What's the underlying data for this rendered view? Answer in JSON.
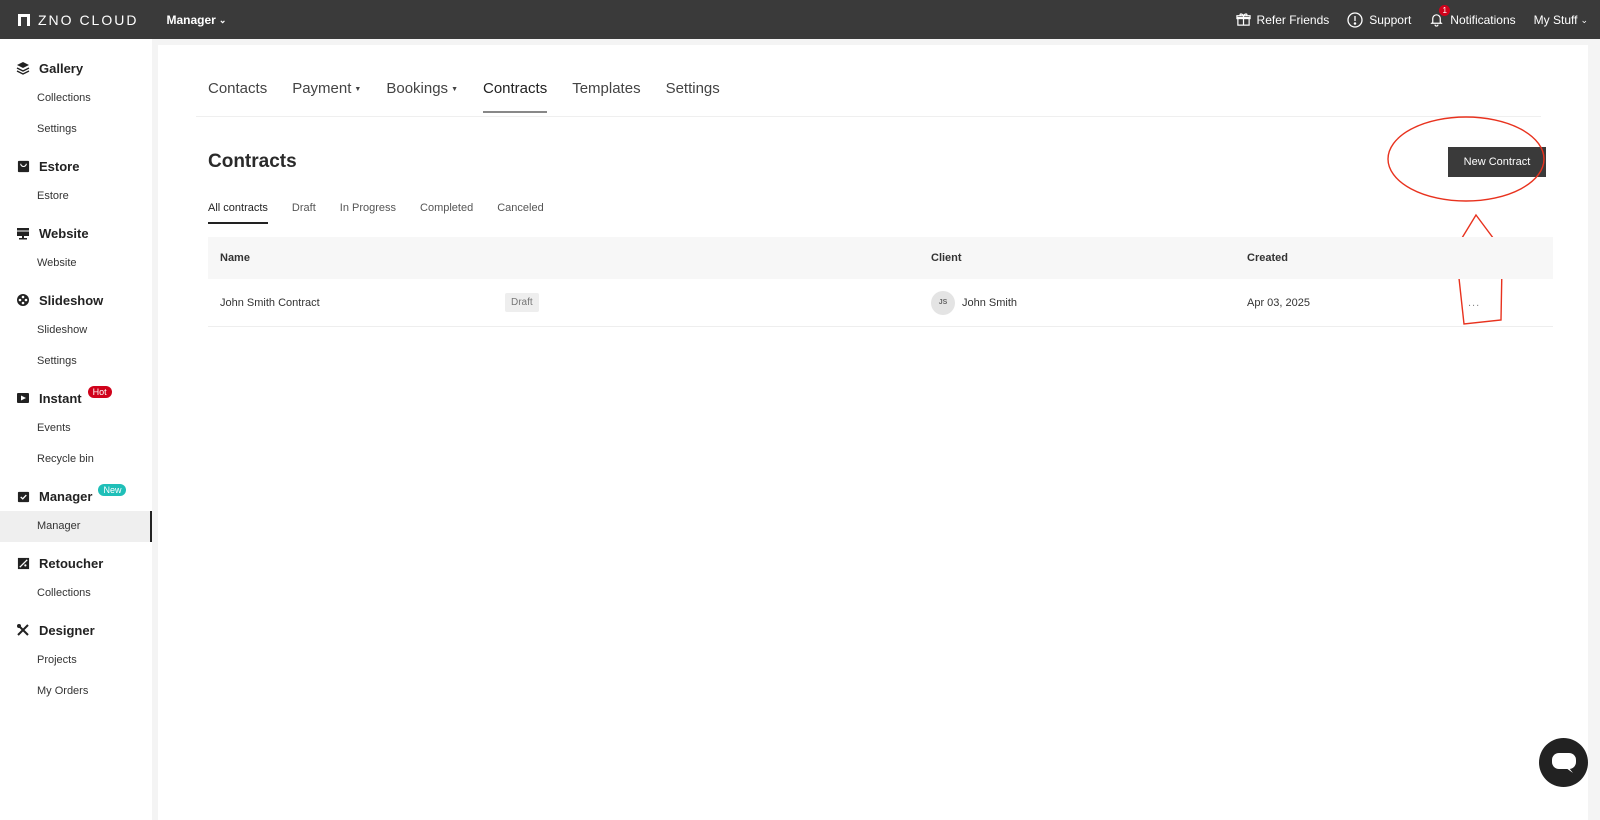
{
  "topbar": {
    "logo_text": "ZNO CLOUD",
    "app_switch": "Manager",
    "refer_label": "Refer Friends",
    "support_label": "Support",
    "notifications_label": "Notifications",
    "notifications_count": "1",
    "my_stuff_label": "My Stuff"
  },
  "sidebar": {
    "gallery": {
      "label": "Gallery",
      "items": [
        "Collections",
        "Settings"
      ]
    },
    "estore": {
      "label": "Estore",
      "items": [
        "Estore"
      ]
    },
    "website": {
      "label": "Website",
      "items": [
        "Website"
      ]
    },
    "slideshow": {
      "label": "Slideshow",
      "items": [
        "Slideshow",
        "Settings"
      ]
    },
    "instant": {
      "label": "Instant",
      "badge": "Hot",
      "items": [
        "Events",
        "Recycle bin"
      ]
    },
    "manager": {
      "label": "Manager",
      "badge": "New",
      "items": [
        "Manager"
      ]
    },
    "retoucher": {
      "label": "Retoucher",
      "items": [
        "Collections"
      ]
    },
    "designer": {
      "label": "Designer",
      "items": [
        "Projects",
        "My Orders"
      ]
    }
  },
  "nav_tabs": [
    "Contacts",
    "Payment",
    "Bookings",
    "Contracts",
    "Templates",
    "Settings"
  ],
  "page": {
    "title": "Contracts",
    "new_button": "New Contract"
  },
  "sub_tabs": [
    "All contracts",
    "Draft",
    "In Progress",
    "Completed",
    "Canceled"
  ],
  "table": {
    "headers": {
      "name": "Name",
      "client": "Client",
      "created": "Created"
    },
    "rows": [
      {
        "name": "John Smith Contract",
        "status": "Draft",
        "client_initials": "JS",
        "client": "John Smith",
        "created": "Apr 03, 2025",
        "actions": "..."
      }
    ]
  },
  "colors": {
    "topbar": "#3a3a3a",
    "hot_badge": "#d0021b",
    "new_badge": "#1fbfb8",
    "annotation": "#e8321e"
  }
}
